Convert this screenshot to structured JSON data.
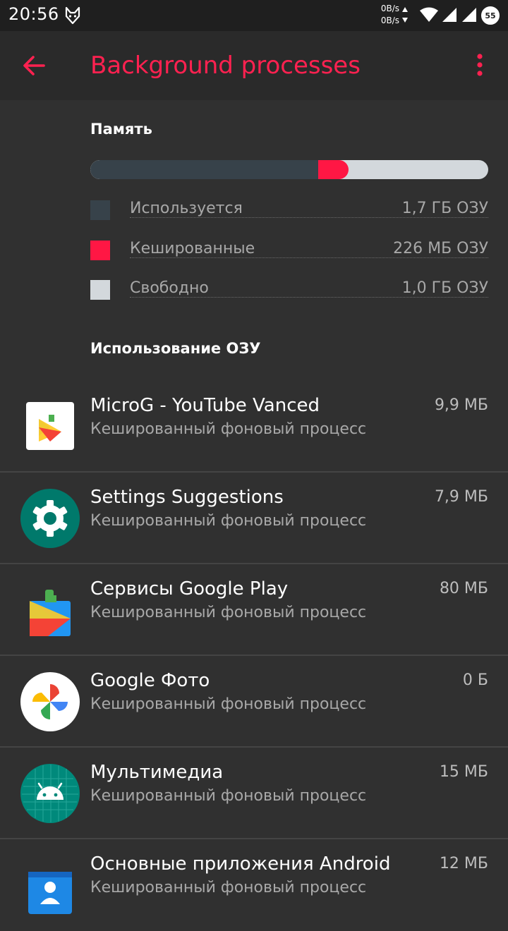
{
  "status_bar": {
    "time": "20:56",
    "net_up": "0B/s",
    "net_down": "0B/s",
    "battery": "55"
  },
  "app_bar": {
    "title": "Background processes",
    "accent_color": "#ff2150"
  },
  "memory": {
    "section_title": "Память",
    "used_fraction": 0.58,
    "cached_fraction": 0.07,
    "legend": [
      {
        "label": "Используется",
        "value": "1,7 ГБ ОЗУ",
        "color": "#37424a"
      },
      {
        "label": "Кешированные",
        "value": "226 МБ ОЗУ",
        "color": "#ff1744"
      },
      {
        "label": "Свободно",
        "value": "1,0 ГБ ОЗУ",
        "color": "#d3d8dc"
      }
    ]
  },
  "ram_usage": {
    "section_title": "Использование ОЗУ",
    "processes": [
      {
        "name": "MicroG - YouTube Vanced",
        "status": "Кешированный фоновый процесс",
        "size": "9,9 МБ",
        "icon": "microg-icon"
      },
      {
        "name": "Settings Suggestions",
        "status": "Кешированный фоновый процесс",
        "size": "7,9 МБ",
        "icon": "gear-icon"
      },
      {
        "name": "Сервисы Google Play",
        "status": "Кешированный фоновый процесс",
        "size": "80 МБ",
        "icon": "google-play-services-icon"
      },
      {
        "name": "Google Фото",
        "status": "Кешированный фоновый процесс",
        "size": "0 Б",
        "icon": "google-photos-icon"
      },
      {
        "name": "Мультимедиа",
        "status": "Кешированный фоновый процесс",
        "size": "15 МБ",
        "icon": "android-icon"
      },
      {
        "name": "Основные приложения Android",
        "status": "Кешированный фоновый процесс",
        "size": "12 МБ",
        "icon": "android-apps-icon"
      }
    ]
  }
}
